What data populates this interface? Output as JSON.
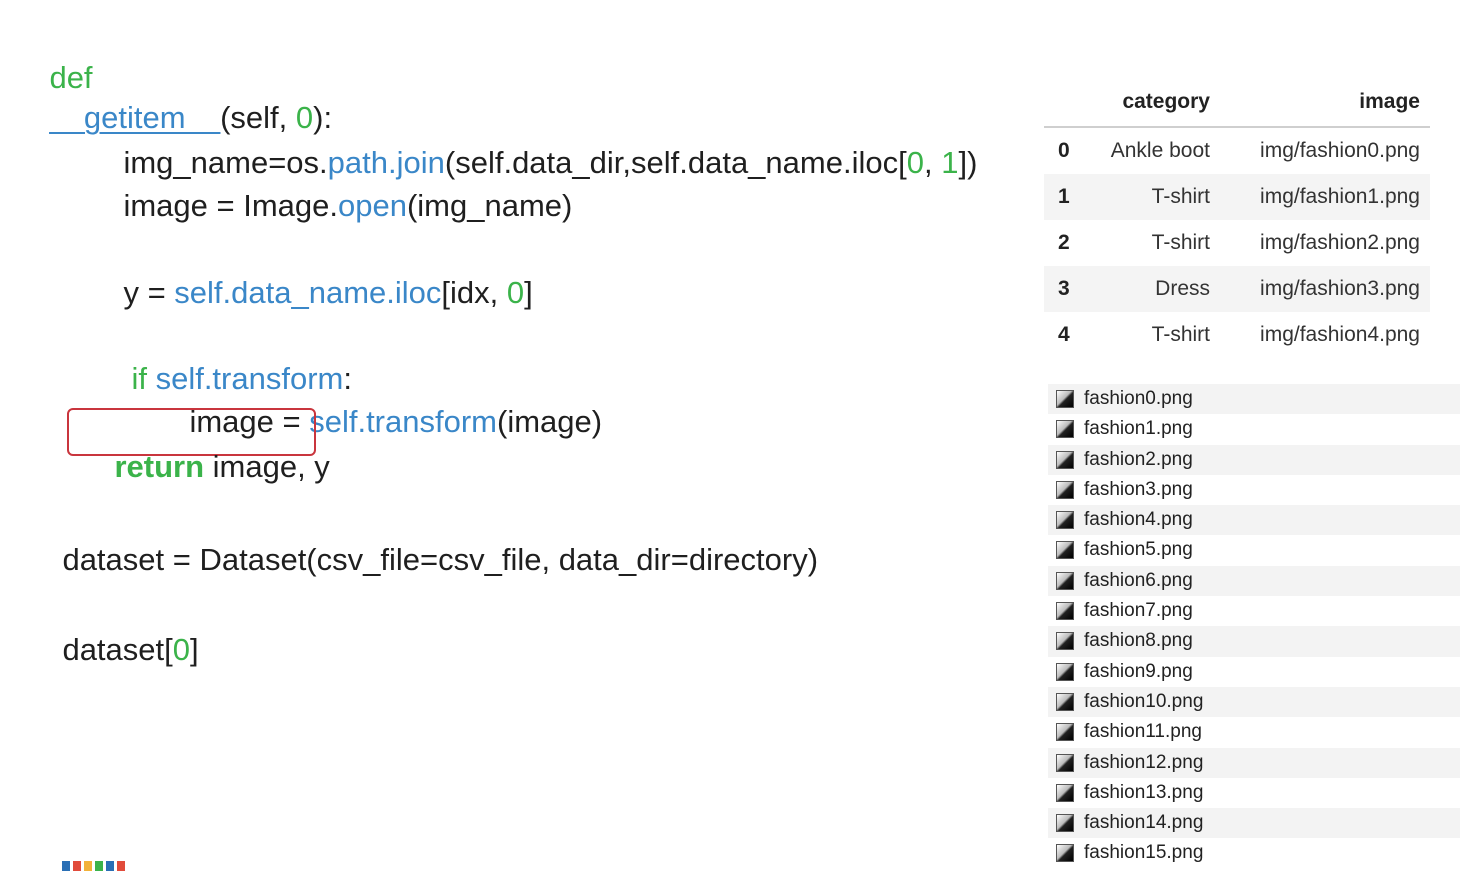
{
  "code": {
    "def_kw": "def",
    "func_name": "__getitem__",
    "params_open": "(self, ",
    "param_zero": "0",
    "params_close": "):",
    "l2_a": "img_name=os.",
    "l2_path": "path",
    "l2_dot": ".",
    "l2_join": "join",
    "l2_b": "(self.data_dir,self.data_name.iloc[",
    "l2_zero": "0",
    "l2_comma": ", ",
    "l2_one": "1",
    "l2_c": "])",
    "l3_a": "image = Image.",
    "l3_open": "open",
    "l3_b": "(img_name)",
    "l4_a": "y = ",
    "l4_attr": "self.data_name.iloc",
    "l4_b": "[idx, ",
    "l4_zero": "0",
    "l4_c": "]",
    "l5_if": "if ",
    "l5_attr": "self.transform",
    "l5_colon": ":",
    "l6_a": "image = ",
    "l6_attr": "self.transform",
    "l6_b": "(image)",
    "l7_return": "return",
    "l7_rest": " image, y",
    "l8": "dataset = Dataset(csv_file=csv_file, data_dir=directory)",
    "l9_a": "dataset[",
    "l9_zero": "0",
    "l9_b": "]"
  },
  "table": {
    "headers": {
      "category": "category",
      "image": "image"
    },
    "rows": [
      {
        "idx": "0",
        "category": "Ankle boot",
        "image": "img/fashion0.png"
      },
      {
        "idx": "1",
        "category": "T-shirt",
        "image": "img/fashion1.png"
      },
      {
        "idx": "2",
        "category": "T-shirt",
        "image": "img/fashion2.png"
      },
      {
        "idx": "3",
        "category": "Dress",
        "image": "img/fashion3.png"
      },
      {
        "idx": "4",
        "category": "T-shirt",
        "image": "img/fashion4.png"
      }
    ]
  },
  "files": [
    "fashion0.png",
    "fashion1.png",
    "fashion2.png",
    "fashion3.png",
    "fashion4.png",
    "fashion5.png",
    "fashion6.png",
    "fashion7.png",
    "fashion8.png",
    "fashion9.png",
    "fashion10.png",
    "fashion11.png",
    "fashion12.png",
    "fashion13.png",
    "fashion14.png",
    "fashion15.png"
  ],
  "colors": {
    "keyword": "#3bb34a",
    "attribute": "#3a87c8",
    "highlight_box": "#c9353d"
  }
}
